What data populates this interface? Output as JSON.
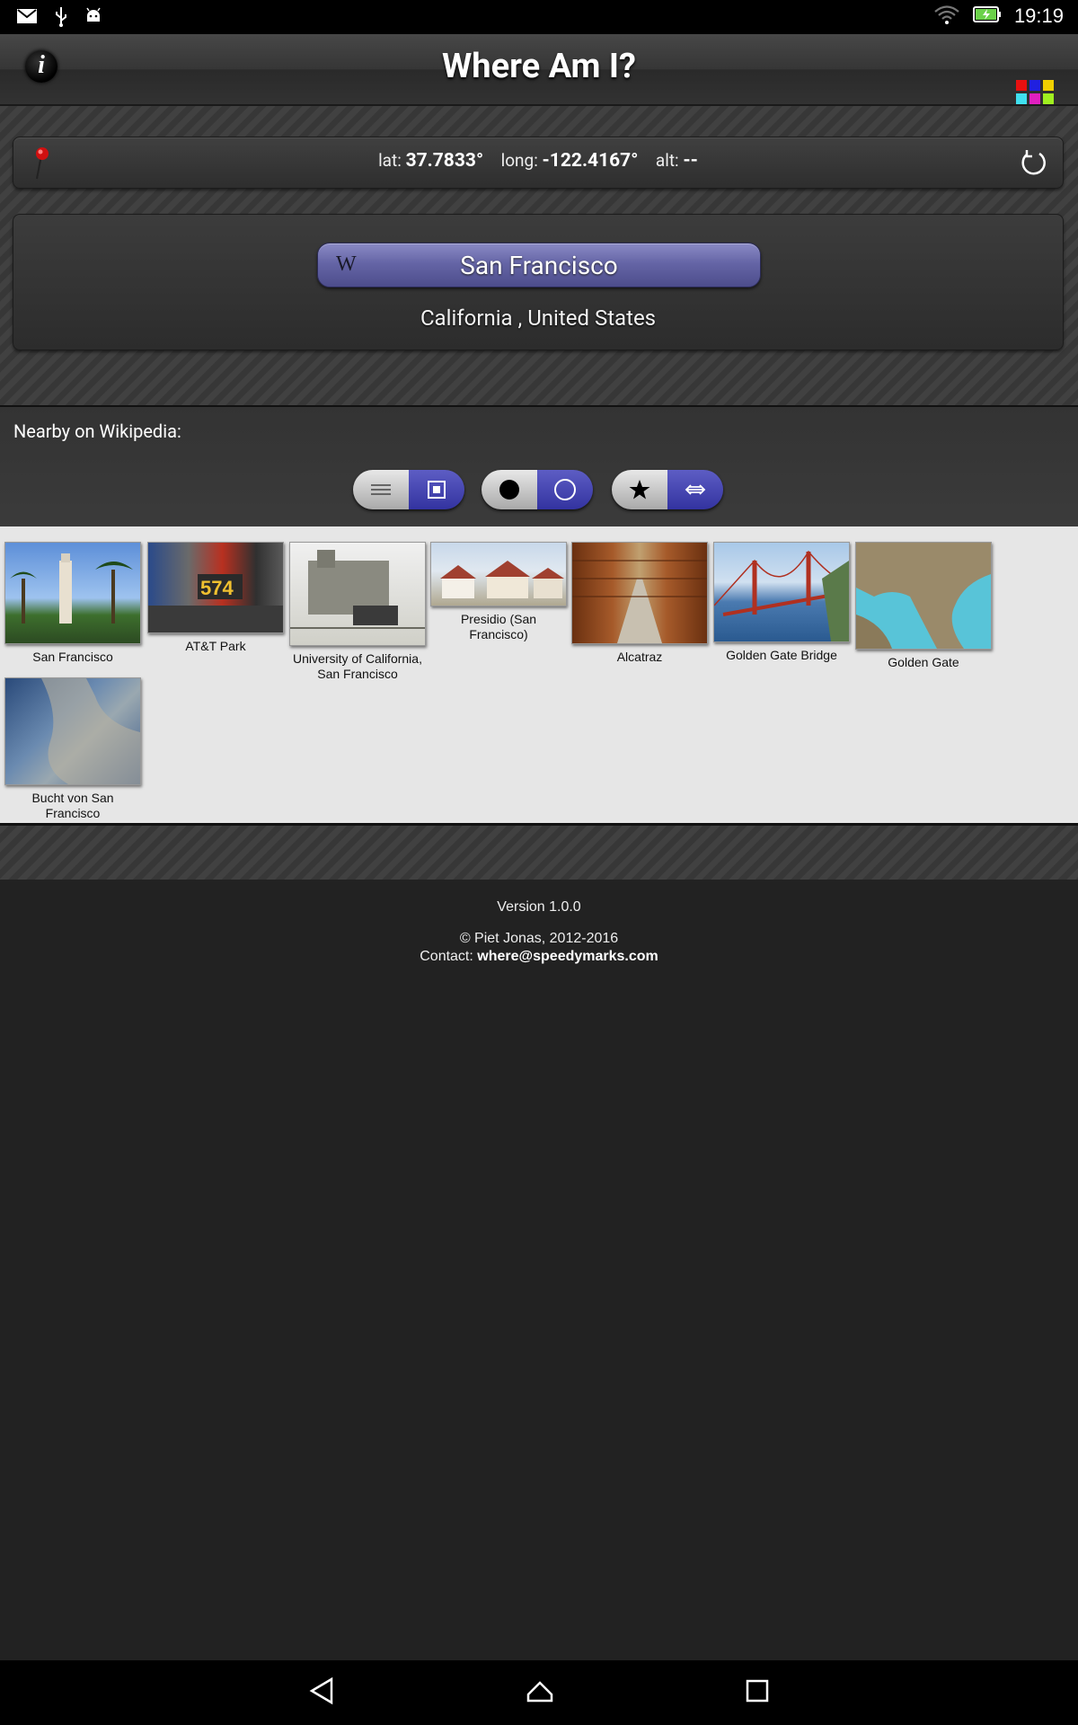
{
  "status_bar": {
    "time": "19:19",
    "left_icons": [
      "gmail-icon",
      "usb-icon",
      "android-debug-icon"
    ],
    "right_icons": [
      "wifi-icon",
      "battery-charging-icon"
    ]
  },
  "header": {
    "title": "Where Am I?",
    "info_label": "i"
  },
  "coords": {
    "lat_label": "lat:",
    "lat_value": "37.7833°",
    "long_label": "long:",
    "long_value": "-122.4167°",
    "alt_label": "alt:",
    "alt_value": "--"
  },
  "location": {
    "wiki_letter": "W",
    "city": "San Francisco",
    "region": "California , United States"
  },
  "nearby": {
    "label": "Nearby on Wikipedia:",
    "toggles": [
      {
        "name": "view-toggle",
        "options": [
          "☰",
          "▣"
        ],
        "selected": 1
      },
      {
        "name": "marker-toggle",
        "options": [
          "●",
          "○"
        ],
        "selected": 1
      },
      {
        "name": "sort-toggle",
        "options": [
          "★",
          "⇔"
        ],
        "selected": 1
      }
    ],
    "items": [
      {
        "title": "San Francisco"
      },
      {
        "title": "AT&T Park"
      },
      {
        "title": "University of California, San Francisco"
      },
      {
        "title": "Presidio (San Francisco)"
      },
      {
        "title": "Alcatraz"
      },
      {
        "title": "Golden Gate Bridge"
      },
      {
        "title": "Golden Gate"
      },
      {
        "title": "Bucht von San Francisco"
      }
    ]
  },
  "footer": {
    "version": "Version 1.0.0",
    "copyright": "© Piet Jonas, 2012-2016",
    "contact_label": "Contact:",
    "contact_email": "where@speedymarks.com"
  },
  "colors": {
    "accent_blue": "#4040b0",
    "city_button": "#6565a6"
  }
}
